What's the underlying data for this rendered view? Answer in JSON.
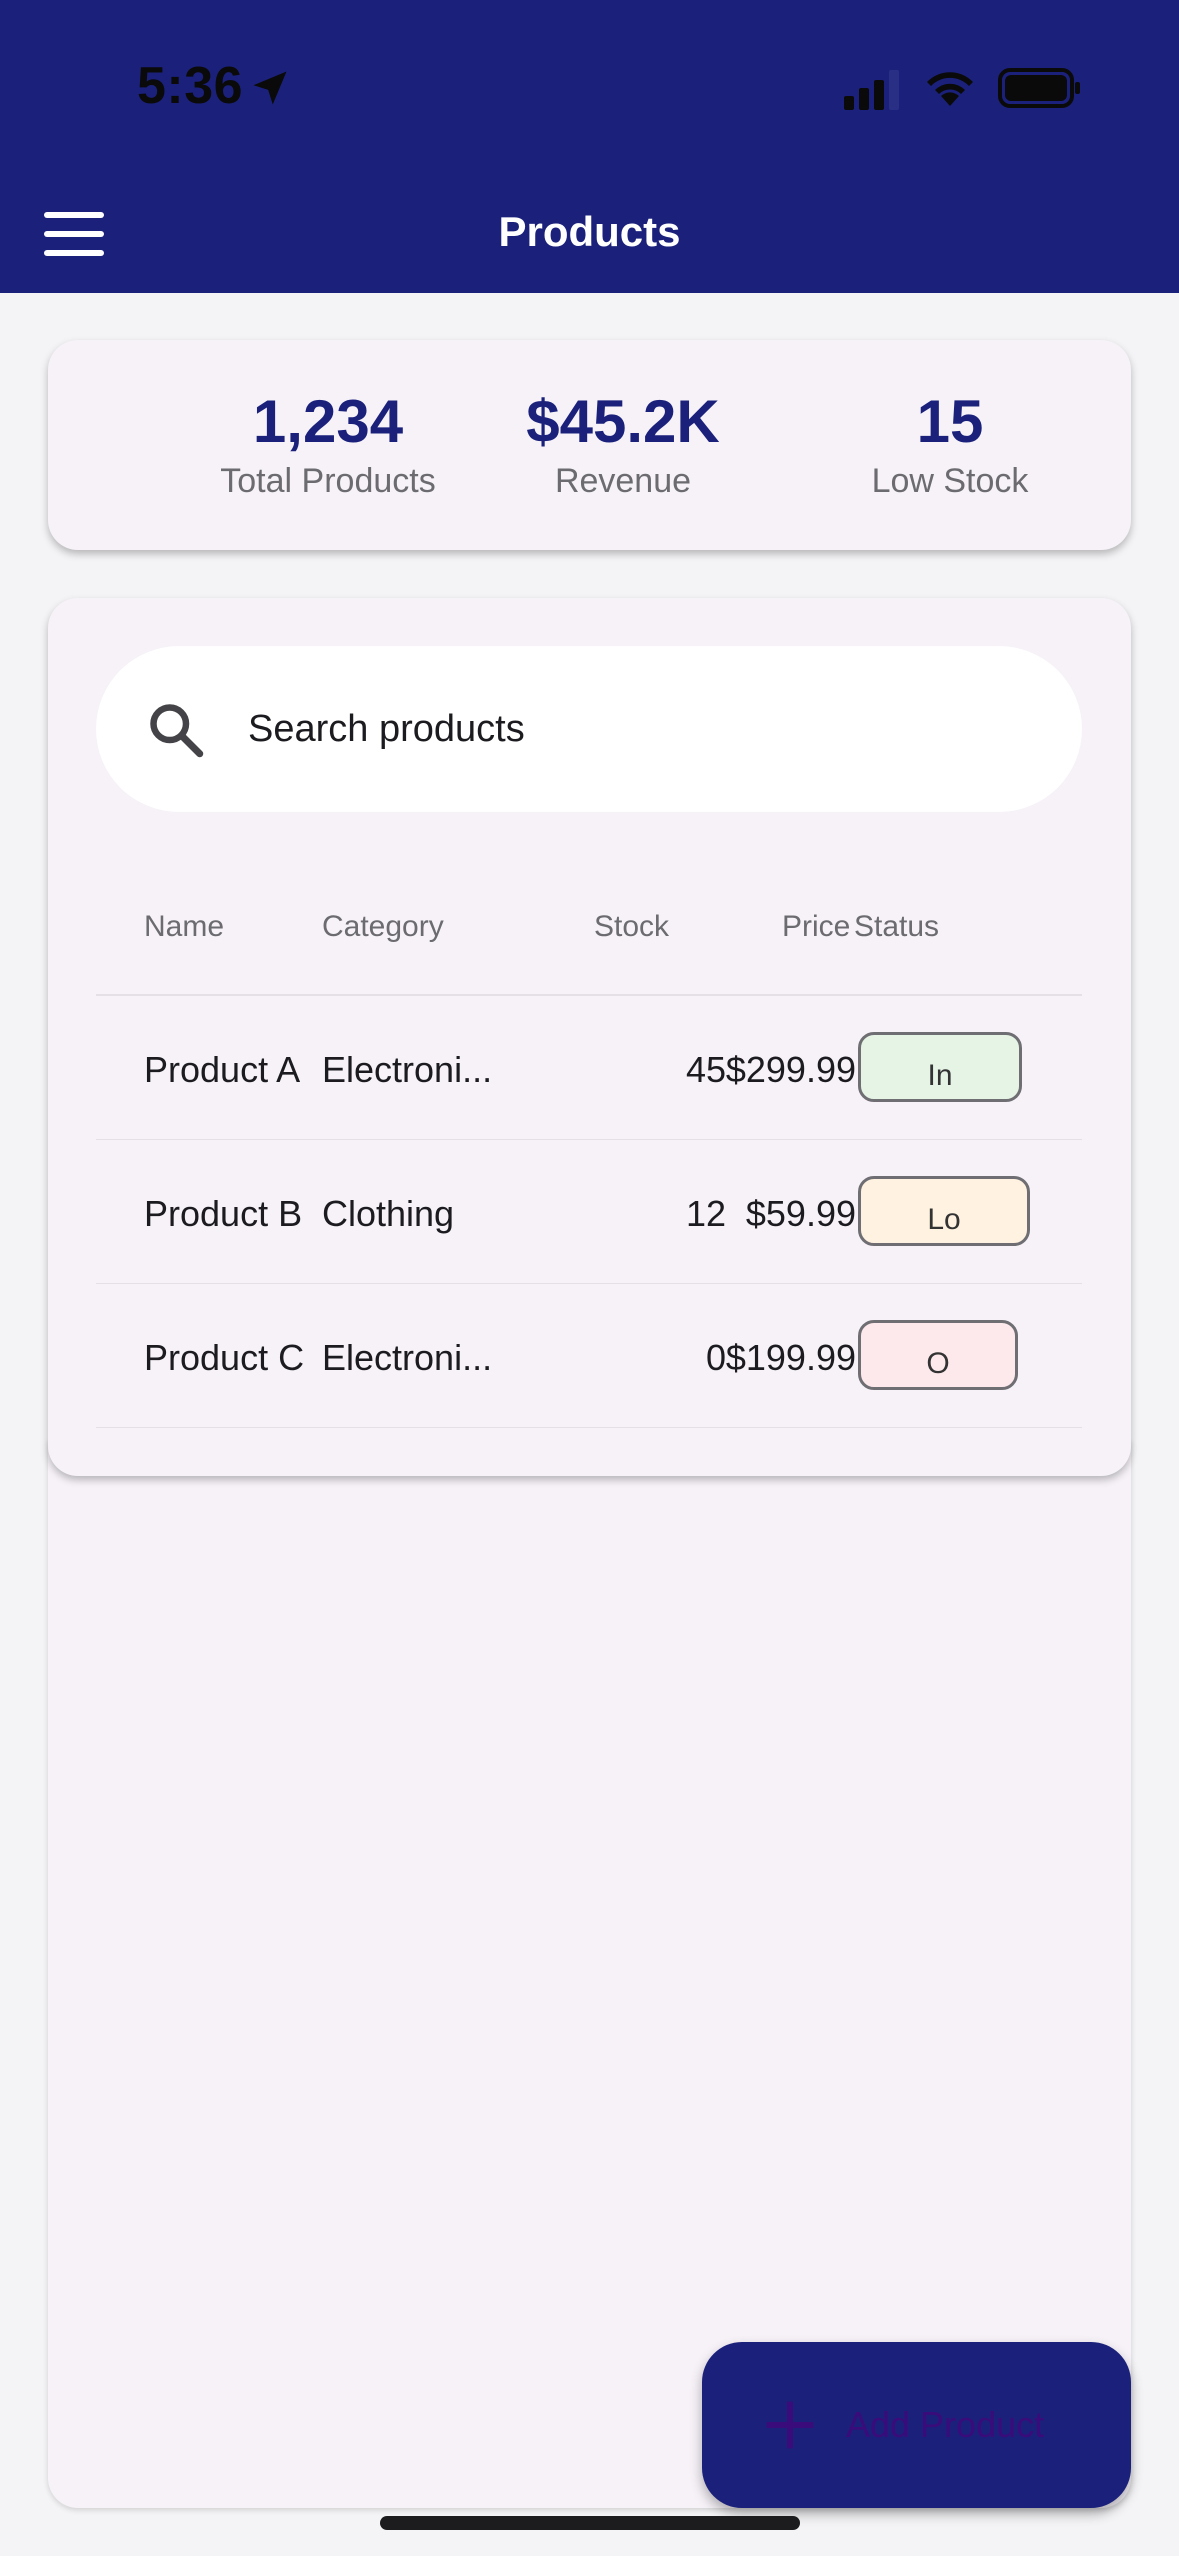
{
  "status_bar": {
    "time": "5:36"
  },
  "app_bar": {
    "title": "Products"
  },
  "stats": [
    {
      "value": "1,234",
      "label": "Total Products"
    },
    {
      "value": "$45.2K",
      "label": "Revenue"
    },
    {
      "value": "15",
      "label": "Low Stock"
    }
  ],
  "search": {
    "placeholder": "Search products"
  },
  "table": {
    "headers": {
      "name": "Name",
      "category": "Category",
      "stock": "Stock",
      "price": "Price",
      "status": "Status"
    },
    "rows": [
      {
        "name": "Product A",
        "category": "Electroni...",
        "stock": "45",
        "price": "$299.99",
        "status": "In"
      },
      {
        "name": "Product B",
        "category": "Clothing",
        "stock": "12",
        "price": "$59.99",
        "status": "Lo"
      },
      {
        "name": "Product C",
        "category": "Electroni...",
        "stock": "0",
        "price": "$199.99",
        "status": "O"
      }
    ]
  },
  "fab": {
    "label": "Add Product"
  },
  "colors": {
    "primary": "#1b217b",
    "card_bg": "#f6f2f8",
    "status_in": "#e6f4e6",
    "status_low": "#fff2e0",
    "status_out": "#fde9ec"
  }
}
